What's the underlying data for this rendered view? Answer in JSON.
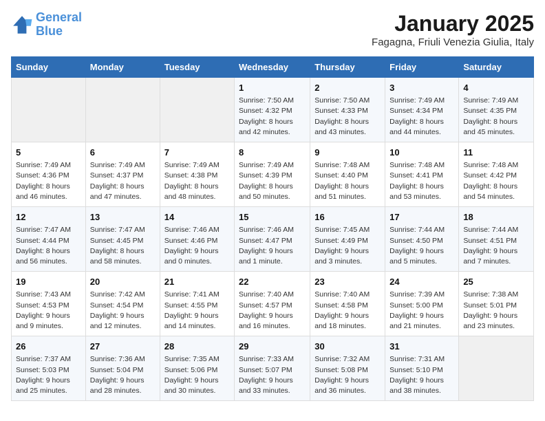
{
  "header": {
    "logo_line1": "General",
    "logo_line2": "Blue",
    "title": "January 2025",
    "subtitle": "Fagagna, Friuli Venezia Giulia, Italy"
  },
  "days_of_week": [
    "Sunday",
    "Monday",
    "Tuesday",
    "Wednesday",
    "Thursday",
    "Friday",
    "Saturday"
  ],
  "weeks": [
    [
      {
        "day": "",
        "info": ""
      },
      {
        "day": "",
        "info": ""
      },
      {
        "day": "",
        "info": ""
      },
      {
        "day": "1",
        "info": "Sunrise: 7:50 AM\nSunset: 4:32 PM\nDaylight: 8 hours and 42 minutes."
      },
      {
        "day": "2",
        "info": "Sunrise: 7:50 AM\nSunset: 4:33 PM\nDaylight: 8 hours and 43 minutes."
      },
      {
        "day": "3",
        "info": "Sunrise: 7:49 AM\nSunset: 4:34 PM\nDaylight: 8 hours and 44 minutes."
      },
      {
        "day": "4",
        "info": "Sunrise: 7:49 AM\nSunset: 4:35 PM\nDaylight: 8 hours and 45 minutes."
      }
    ],
    [
      {
        "day": "5",
        "info": "Sunrise: 7:49 AM\nSunset: 4:36 PM\nDaylight: 8 hours and 46 minutes."
      },
      {
        "day": "6",
        "info": "Sunrise: 7:49 AM\nSunset: 4:37 PM\nDaylight: 8 hours and 47 minutes."
      },
      {
        "day": "7",
        "info": "Sunrise: 7:49 AM\nSunset: 4:38 PM\nDaylight: 8 hours and 48 minutes."
      },
      {
        "day": "8",
        "info": "Sunrise: 7:49 AM\nSunset: 4:39 PM\nDaylight: 8 hours and 50 minutes."
      },
      {
        "day": "9",
        "info": "Sunrise: 7:48 AM\nSunset: 4:40 PM\nDaylight: 8 hours and 51 minutes."
      },
      {
        "day": "10",
        "info": "Sunrise: 7:48 AM\nSunset: 4:41 PM\nDaylight: 8 hours and 53 minutes."
      },
      {
        "day": "11",
        "info": "Sunrise: 7:48 AM\nSunset: 4:42 PM\nDaylight: 8 hours and 54 minutes."
      }
    ],
    [
      {
        "day": "12",
        "info": "Sunrise: 7:47 AM\nSunset: 4:44 PM\nDaylight: 8 hours and 56 minutes."
      },
      {
        "day": "13",
        "info": "Sunrise: 7:47 AM\nSunset: 4:45 PM\nDaylight: 8 hours and 58 minutes."
      },
      {
        "day": "14",
        "info": "Sunrise: 7:46 AM\nSunset: 4:46 PM\nDaylight: 9 hours and 0 minutes."
      },
      {
        "day": "15",
        "info": "Sunrise: 7:46 AM\nSunset: 4:47 PM\nDaylight: 9 hours and 1 minute."
      },
      {
        "day": "16",
        "info": "Sunrise: 7:45 AM\nSunset: 4:49 PM\nDaylight: 9 hours and 3 minutes."
      },
      {
        "day": "17",
        "info": "Sunrise: 7:44 AM\nSunset: 4:50 PM\nDaylight: 9 hours and 5 minutes."
      },
      {
        "day": "18",
        "info": "Sunrise: 7:44 AM\nSunset: 4:51 PM\nDaylight: 9 hours and 7 minutes."
      }
    ],
    [
      {
        "day": "19",
        "info": "Sunrise: 7:43 AM\nSunset: 4:53 PM\nDaylight: 9 hours and 9 minutes."
      },
      {
        "day": "20",
        "info": "Sunrise: 7:42 AM\nSunset: 4:54 PM\nDaylight: 9 hours and 12 minutes."
      },
      {
        "day": "21",
        "info": "Sunrise: 7:41 AM\nSunset: 4:55 PM\nDaylight: 9 hours and 14 minutes."
      },
      {
        "day": "22",
        "info": "Sunrise: 7:40 AM\nSunset: 4:57 PM\nDaylight: 9 hours and 16 minutes."
      },
      {
        "day": "23",
        "info": "Sunrise: 7:40 AM\nSunset: 4:58 PM\nDaylight: 9 hours and 18 minutes."
      },
      {
        "day": "24",
        "info": "Sunrise: 7:39 AM\nSunset: 5:00 PM\nDaylight: 9 hours and 21 minutes."
      },
      {
        "day": "25",
        "info": "Sunrise: 7:38 AM\nSunset: 5:01 PM\nDaylight: 9 hours and 23 minutes."
      }
    ],
    [
      {
        "day": "26",
        "info": "Sunrise: 7:37 AM\nSunset: 5:03 PM\nDaylight: 9 hours and 25 minutes."
      },
      {
        "day": "27",
        "info": "Sunrise: 7:36 AM\nSunset: 5:04 PM\nDaylight: 9 hours and 28 minutes."
      },
      {
        "day": "28",
        "info": "Sunrise: 7:35 AM\nSunset: 5:06 PM\nDaylight: 9 hours and 30 minutes."
      },
      {
        "day": "29",
        "info": "Sunrise: 7:33 AM\nSunset: 5:07 PM\nDaylight: 9 hours and 33 minutes."
      },
      {
        "day": "30",
        "info": "Sunrise: 7:32 AM\nSunset: 5:08 PM\nDaylight: 9 hours and 36 minutes."
      },
      {
        "day": "31",
        "info": "Sunrise: 7:31 AM\nSunset: 5:10 PM\nDaylight: 9 hours and 38 minutes."
      },
      {
        "day": "",
        "info": ""
      }
    ]
  ]
}
